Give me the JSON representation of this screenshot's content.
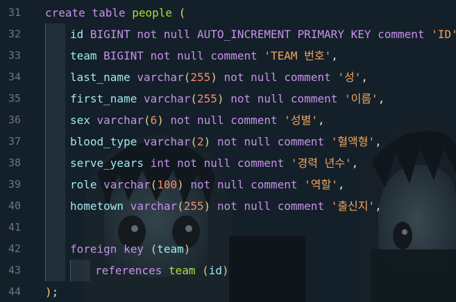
{
  "editor": {
    "line_numbers": [
      "31",
      "32",
      "33",
      "34",
      "35",
      "36",
      "37",
      "38",
      "39",
      "40",
      "41",
      "42",
      "43",
      "44"
    ],
    "lines": [
      [
        {
          "t": "create table ",
          "c": "kw"
        },
        {
          "t": "people",
          "c": "fn"
        },
        {
          "t": " ",
          "c": "plain"
        },
        {
          "t": "(",
          "c": "br"
        }
      ],
      [
        {
          "t": "id",
          "c": "id"
        },
        {
          "t": " BIGINT not null AUTO_INCREMENT PRIMARY KEY comment ",
          "c": "kw"
        },
        {
          "t": "'ID'",
          "c": "str"
        },
        {
          "t": ",",
          "c": "plain"
        }
      ],
      [
        {
          "t": "team",
          "c": "id"
        },
        {
          "t": " BIGINT not null comment ",
          "c": "kw"
        },
        {
          "t": "'TEAM 번호'",
          "c": "str"
        },
        {
          "t": ",",
          "c": "plain"
        }
      ],
      [
        {
          "t": "last_name",
          "c": "id"
        },
        {
          "t": " varchar",
          "c": "kw"
        },
        {
          "t": "(",
          "c": "br2"
        },
        {
          "t": "255",
          "c": "num"
        },
        {
          "t": ")",
          "c": "br2"
        },
        {
          "t": " not null comment ",
          "c": "kw"
        },
        {
          "t": "'성'",
          "c": "str"
        },
        {
          "t": ",",
          "c": "plain"
        }
      ],
      [
        {
          "t": "first_name",
          "c": "id"
        },
        {
          "t": " varchar",
          "c": "kw"
        },
        {
          "t": "(",
          "c": "br2"
        },
        {
          "t": "255",
          "c": "num"
        },
        {
          "t": ")",
          "c": "br2"
        },
        {
          "t": " not null comment ",
          "c": "kw"
        },
        {
          "t": "'이름'",
          "c": "str"
        },
        {
          "t": ",",
          "c": "plain"
        }
      ],
      [
        {
          "t": "sex",
          "c": "id"
        },
        {
          "t": " varchar",
          "c": "kw"
        },
        {
          "t": "(",
          "c": "br2"
        },
        {
          "t": "6",
          "c": "num"
        },
        {
          "t": ")",
          "c": "br2"
        },
        {
          "t": " not null comment ",
          "c": "kw"
        },
        {
          "t": "'성별'",
          "c": "str"
        },
        {
          "t": ",",
          "c": "plain"
        }
      ],
      [
        {
          "t": "blood_type",
          "c": "id"
        },
        {
          "t": " varchar",
          "c": "kw"
        },
        {
          "t": "(",
          "c": "br2"
        },
        {
          "t": "2",
          "c": "num"
        },
        {
          "t": ")",
          "c": "br2"
        },
        {
          "t": " not null comment ",
          "c": "kw"
        },
        {
          "t": "'혈액형'",
          "c": "str"
        },
        {
          "t": ",",
          "c": "plain"
        }
      ],
      [
        {
          "t": "serve_years",
          "c": "id"
        },
        {
          "t": " int not null comment ",
          "c": "kw"
        },
        {
          "t": "'경력 년수'",
          "c": "str"
        },
        {
          "t": ",",
          "c": "plain"
        }
      ],
      [
        {
          "t": "role",
          "c": "id"
        },
        {
          "t": " varchar",
          "c": "kw"
        },
        {
          "t": "(",
          "c": "br2"
        },
        {
          "t": "100",
          "c": "num"
        },
        {
          "t": ")",
          "c": "br2"
        },
        {
          "t": " not null comment ",
          "c": "kw"
        },
        {
          "t": "'역할'",
          "c": "str"
        },
        {
          "t": ",",
          "c": "plain"
        }
      ],
      [
        {
          "t": "hometown",
          "c": "id"
        },
        {
          "t": " varchar",
          "c": "kw"
        },
        {
          "t": "(",
          "c": "br2"
        },
        {
          "t": "255",
          "c": "num"
        },
        {
          "t": ")",
          "c": "br2"
        },
        {
          "t": " not null comment ",
          "c": "kw"
        },
        {
          "t": "'출신지'",
          "c": "str"
        },
        {
          "t": ",",
          "c": "plain"
        }
      ],
      [],
      [
        {
          "t": "foreign key ",
          "c": "kw"
        },
        {
          "t": "(",
          "c": "br2"
        },
        {
          "t": "team",
          "c": "id"
        },
        {
          "t": ")",
          "c": "br2"
        }
      ],
      [
        {
          "t": "references ",
          "c": "kw"
        },
        {
          "t": "team",
          "c": "fn"
        },
        {
          "t": " ",
          "c": "plain"
        },
        {
          "t": "(",
          "c": "br2"
        },
        {
          "t": "id",
          "c": "id"
        },
        {
          "t": ")",
          "c": "br2"
        }
      ],
      [
        {
          "t": ")",
          "c": "br"
        },
        {
          "t": ";",
          "c": "plain"
        }
      ]
    ],
    "indent_levels": [
      0,
      1,
      1,
      1,
      1,
      1,
      1,
      1,
      1,
      1,
      1,
      1,
      2,
      0
    ]
  }
}
